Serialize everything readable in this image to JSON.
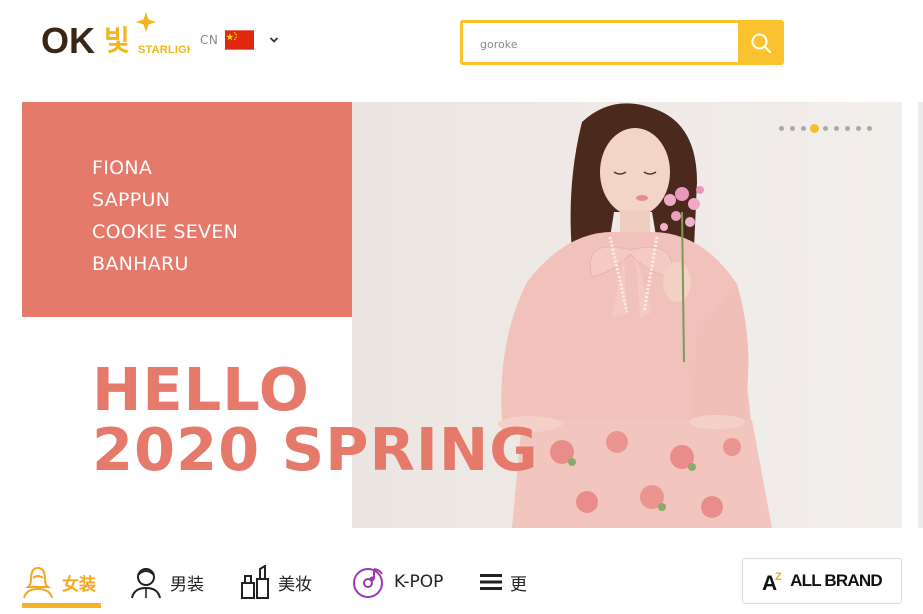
{
  "header": {
    "logo": {
      "main": "OK",
      "korean": "빛",
      "sub": "STARLIGHT"
    },
    "language": {
      "code": "CN",
      "flag": "cn-flag-icon"
    },
    "search": {
      "value": "goroke",
      "placeholder": "goroke"
    }
  },
  "banner": {
    "brands": [
      "FIONA",
      "SAPPUN",
      "COOKIE SEVEN",
      "BANHARU"
    ],
    "headline_line1": "HELLO",
    "headline_line2": "2020 SPRING",
    "slide_count": 9,
    "active_slide": 4
  },
  "nav": {
    "items": [
      {
        "label": "女装",
        "icon": "woman-icon",
        "active": true
      },
      {
        "label": "男装",
        "icon": "man-icon",
        "active": false
      },
      {
        "label": "美妆",
        "icon": "cosmetics-icon",
        "active": false
      },
      {
        "label": "K-POP",
        "icon": "music-disc-icon",
        "active": false
      },
      {
        "label": "更",
        "icon": "menu-icon",
        "active": false
      }
    ],
    "all_brand": {
      "icon": "az-icon",
      "label": "ALL BRAND"
    }
  },
  "colors": {
    "accent_yellow": "#f9c22e",
    "coral": "#e57a6b",
    "nav_active": "#f2a823"
  }
}
